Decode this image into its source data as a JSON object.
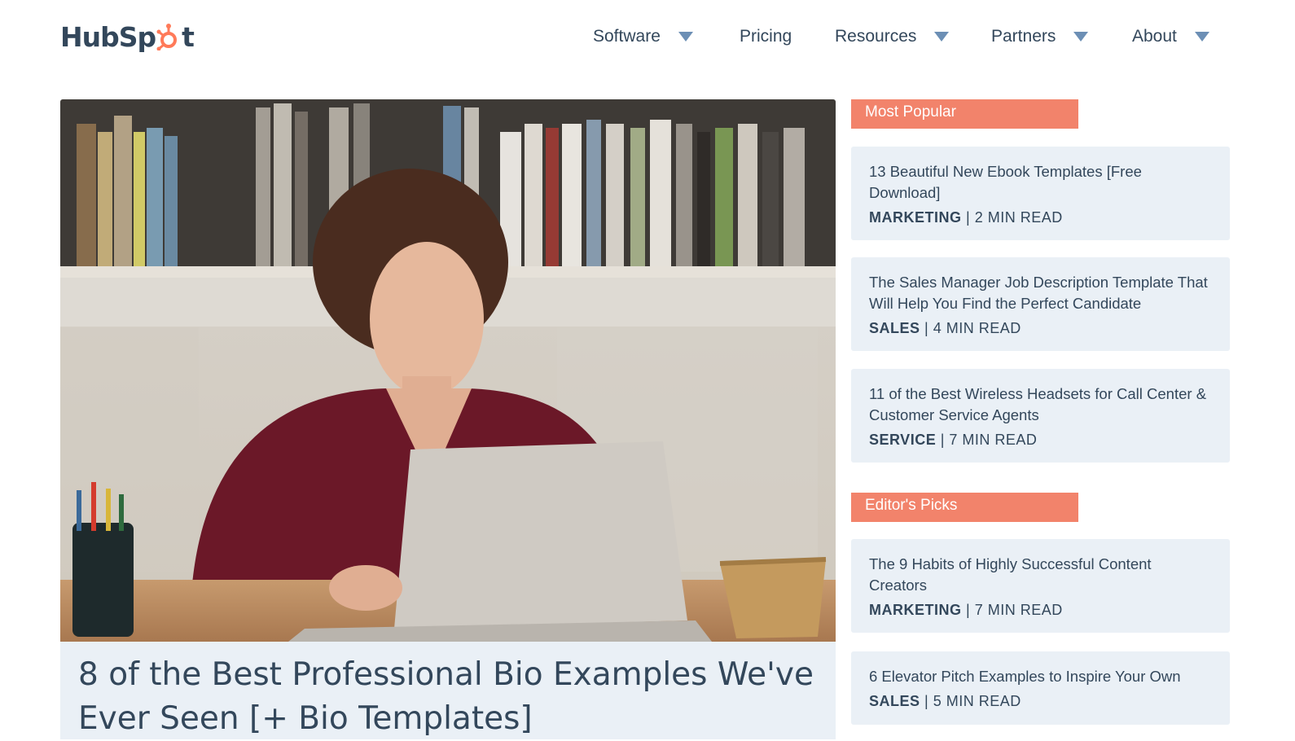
{
  "header": {
    "logo_text_left": "HubSp",
    "logo_text_right": "t",
    "nav": [
      {
        "label": "Software",
        "dropdown": true
      },
      {
        "label": "Pricing",
        "dropdown": false
      },
      {
        "label": "Resources",
        "dropdown": true
      },
      {
        "label": "Partners",
        "dropdown": true
      },
      {
        "label": "About",
        "dropdown": true
      }
    ]
  },
  "hero": {
    "title": "8 of the Best Professional Bio Examples We've Ever Seen [+ Bio Templates]"
  },
  "sidebar": {
    "most_popular_label": "Most Popular",
    "most_popular": [
      {
        "title": "13 Beautiful New Ebook Templates [Free Download]",
        "category": "MARKETING",
        "read": "| 2 MIN READ"
      },
      {
        "title": "The Sales Manager Job Description Template That Will Help You Find the Perfect Candidate",
        "category": "SALES",
        "read": "| 4 MIN READ"
      },
      {
        "title": "11 of the Best Wireless Headsets for Call Center & Customer Service Agents",
        "category": "SERVICE",
        "read": "| 7 MIN READ"
      }
    ],
    "editors_picks_label": "Editor's Picks",
    "editors_picks": [
      {
        "title": "The 9 Habits of Highly Successful Content Creators",
        "category": "MARKETING",
        "read": "| 7 MIN READ"
      },
      {
        "title": "6 Elevator Pitch Examples to Inspire Your Own",
        "category": "SALES",
        "read": "| 5 MIN READ"
      }
    ]
  },
  "colors": {
    "accent": "#f2836b",
    "text": "#33475b",
    "card_bg": "#eaf0f6",
    "logo_orange": "#ff7a59"
  }
}
